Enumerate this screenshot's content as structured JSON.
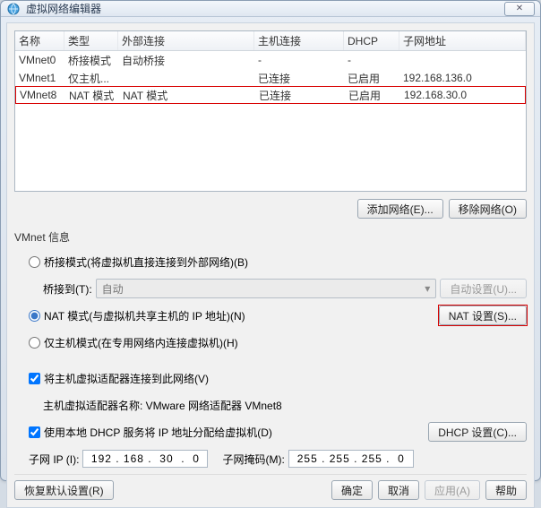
{
  "title": "虚拟网络编辑器",
  "close_glyph": "✕",
  "table": {
    "headers": {
      "name": "名称",
      "type": "类型",
      "ext": "外部连接",
      "host": "主机连接",
      "dhcp": "DHCP",
      "subnet": "子网地址"
    },
    "rows": [
      {
        "name": "VMnet0",
        "type": "桥接模式",
        "ext": "自动桥接",
        "host": "-",
        "dhcp": "-",
        "subnet": ""
      },
      {
        "name": "VMnet1",
        "type": "仅主机...",
        "ext": "",
        "host": "已连接",
        "dhcp": "已启用",
        "subnet": "192.168.136.0"
      },
      {
        "name": "VMnet8",
        "type": "NAT 模式",
        "ext": "NAT 模式",
        "host": "已连接",
        "dhcp": "已启用",
        "subnet": "192.168.30.0"
      }
    ]
  },
  "buttons": {
    "add_net": "添加网络(E)...",
    "remove_net": "移除网络(O)",
    "auto_set": "自动设置(U)...",
    "nat_set": "NAT 设置(S)...",
    "dhcp_set": "DHCP 设置(C)...",
    "restore": "恢复默认设置(R)",
    "ok": "确定",
    "cancel": "取消",
    "apply": "应用(A)",
    "help": "帮助"
  },
  "info": {
    "group": "VMnet 信息",
    "bridged": "桥接模式(将虚拟机直接连接到外部网络)(B)",
    "bridged_to": "桥接到(T):",
    "bridged_to_value": "自动",
    "nat": "NAT 模式(与虚拟机共享主机的 IP 地址)(N)",
    "hostonly": "仅主机模式(在专用网络内连接虚拟机)(H)",
    "attach_adapter": "将主机虚拟适配器连接到此网络(V)",
    "adapter_name": "主机虚拟适配器名称: VMware 网络适配器 VMnet8",
    "use_dhcp": "使用本地 DHCP 服务将 IP 地址分配给虚拟机(D)",
    "subnet_ip_label": "子网 IP (I):",
    "subnet_ip": "192 . 168 .  30  .  0",
    "subnet_mask_label": "子网掩码(M):",
    "subnet_mask": "255 . 255 . 255 .  0"
  }
}
